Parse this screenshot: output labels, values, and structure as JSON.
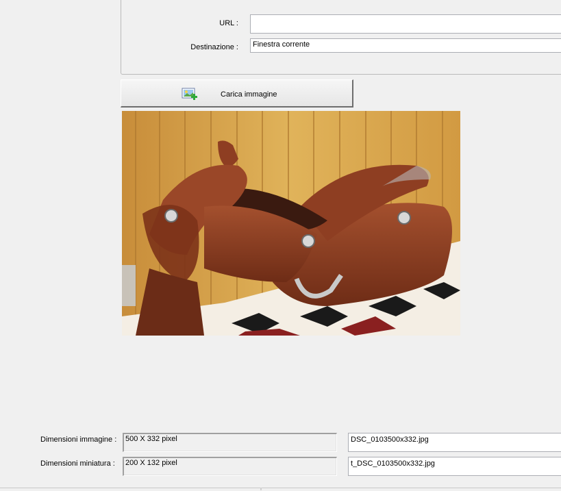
{
  "form": {
    "url_label": "URL :",
    "url_value": "",
    "destination_label": "Destinazione :",
    "destination_value": "Finestra corrente"
  },
  "upload_button": {
    "label": "Carica immagine",
    "icon": "image-add-icon"
  },
  "preview": {
    "description_icon": "saddle-photo"
  },
  "dimensions": {
    "image_label": "Dimensioni immagine :",
    "image_value": "500 X 332 pixel",
    "image_filename": "DSC_0103500x332.jpg",
    "thumb_label": "Dimensioni miniatura :",
    "thumb_value": "200 X 132 pixel",
    "thumb_filename": "t_DSC_0103500x332.jpg"
  },
  "colors": {
    "window_bg": "#f0f0f0",
    "field_border": "#abadb3"
  }
}
